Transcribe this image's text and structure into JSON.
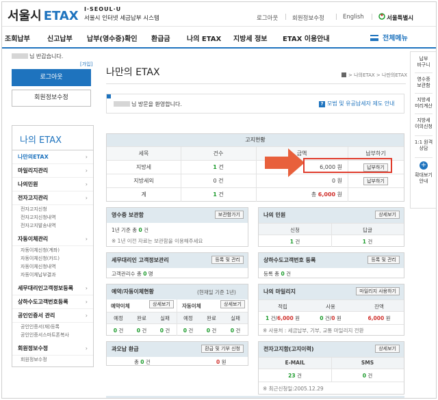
{
  "header": {
    "logo_main": "서울시",
    "logo_etax": "ETAX",
    "logo_slogan": "I·SEOUL·U",
    "logo_sub": "서울시 인터넷 세금납부 시스템",
    "util": [
      "로그아웃",
      "회원정보수정",
      "English"
    ],
    "seoul_label": "서울특별시"
  },
  "gnb": [
    "조회납부",
    "신고납부",
    "납부(영수증)확인",
    "환급금",
    "나의 ETAX",
    "지방세 정보",
    "ETAX 이용안내"
  ],
  "menu_all": "전체메뉴",
  "left": {
    "greeting": "님 반갑습니다.",
    "join": "[가입]",
    "logout": "로그아웃",
    "member_edit": "회원정보수정",
    "lnb_title": "나의 ETAX",
    "items": [
      {
        "label": "나만의ETAX",
        "type": "item",
        "active": true
      },
      {
        "label": "마일리지관리",
        "type": "item"
      },
      {
        "label": "나의민원",
        "type": "item"
      },
      {
        "label": "전자고지관리",
        "type": "item"
      },
      {
        "label": "전자고지신청",
        "type": "sub"
      },
      {
        "label": "전자고지신청내역",
        "type": "sub"
      },
      {
        "label": "전자고지발송내역",
        "type": "sub"
      },
      {
        "label": "자동이체관리",
        "type": "item"
      },
      {
        "label": "자동이체신청(계좌)",
        "type": "sub"
      },
      {
        "label": "자동이체신청(카드)",
        "type": "sub"
      },
      {
        "label": "자동이체신청내역",
        "type": "sub"
      },
      {
        "label": "자동이체납부결과",
        "type": "sub"
      },
      {
        "label": "세무대리인고객정보등록",
        "type": "item"
      },
      {
        "label": "상하수도고객번호등록",
        "type": "item"
      },
      {
        "label": "공인인증서 관리",
        "type": "item"
      },
      {
        "label": "공인인증서(재)등록",
        "type": "sub"
      },
      {
        "label": "공인인증서스마트폰복사",
        "type": "sub"
      },
      {
        "label": "회원정보수정",
        "type": "item"
      },
      {
        "label": "회원정보수정",
        "type": "sub"
      }
    ]
  },
  "quick": [
    "납부\n바구니",
    "영수증\n보관함",
    "지방세\n미리계산",
    "지방세\n이의신청",
    "1:1 원격\n상담",
    "확대보기\n안내"
  ],
  "main": {
    "title": "나만의 ETAX",
    "breadcrumb": "> 나의ETAX > 나만의ETAX",
    "welcome": "님 방문을 환영합니다.",
    "welcome_link": "모범 및 유공납세자 제도 안내",
    "bill": {
      "title": "고지현황",
      "headers": [
        "세목",
        "건수",
        "금액",
        "납부하기"
      ],
      "rows": [
        {
          "item": "지방세",
          "count": "1",
          "count_unit": "건",
          "amount": "6,000",
          "amount_unit": "원",
          "btn": "납부하기"
        },
        {
          "item": "지방세외",
          "count": "0",
          "count_unit": "건",
          "amount": "0",
          "amount_unit": "원",
          "btn": "납부하기"
        },
        {
          "item": "계",
          "count": "1",
          "count_unit": "건",
          "amount_prefix": "총",
          "amount": "6,000",
          "amount_unit": "원"
        }
      ]
    },
    "receipt": {
      "title": "영수증 보관함",
      "btn": "보관함가기",
      "line1_pre": "1년 기준 총",
      "line1_val": "0",
      "line1_unit": "건",
      "note": "※ 1년 이전 자료는 보관함을 이용해주세요"
    },
    "civil": {
      "title": "나의 민원",
      "btn": "상세보기",
      "cols": [
        "신청",
        "답글"
      ],
      "vals": [
        "1",
        "1"
      ],
      "unit": "건"
    },
    "agent": {
      "title": "세무대리인 고객정보관리",
      "btn": "등록 및 관리",
      "line": "고객관리수 총",
      "val": "0",
      "unit": "명"
    },
    "water": {
      "title": "상하수도고객번호 등록",
      "btn": "등록 및 관리",
      "line": "등록 총",
      "val": "0",
      "unit": "건"
    },
    "auto": {
      "title": "예약/자동이체현황",
      "note": "(현재일 기준 1년)",
      "left_title": "예약이체",
      "left_btn": "상세보기",
      "right_title": "자동이체",
      "right_btn": "상세보기",
      "cols": [
        "예정",
        "완료",
        "실패",
        "예정",
        "완료",
        "실패"
      ],
      "vals": [
        "0",
        "0",
        "0",
        "0",
        "0",
        "0"
      ],
      "unit": "건"
    },
    "mileage": {
      "title": "나의 마일리지",
      "btn": "마일리지 사용하기",
      "cols": [
        "적립",
        "사용",
        "잔액"
      ],
      "v1a": "1",
      "v1b": "6,000",
      "v2a": "0",
      "v2b": "0",
      "v3": "6,000",
      "unit_cnt": "건",
      "unit_won": "원",
      "note": "※ 사용처 : 세금납부, 기부, 교통 마일리지 전환"
    },
    "refund": {
      "title": "과오납 환급",
      "btn": "환급 및 기부 신청",
      "pre": "총",
      "val": "0",
      "unit": "건",
      "amount": "0",
      "amount_unit": "원"
    },
    "ebill": {
      "title": "전자고지함(고지이력)",
      "btn": "상세보기",
      "cols": [
        "E-MAIL",
        "SMS"
      ],
      "vals": [
        "23",
        "0"
      ],
      "unit": "건",
      "note": "※ 최근신청일:2005.12.29"
    }
  },
  "colors": {
    "brand": "#1e73be",
    "green": "#1a9a2a",
    "red": "#d0312d",
    "head_bg": "#dfe9ef"
  }
}
